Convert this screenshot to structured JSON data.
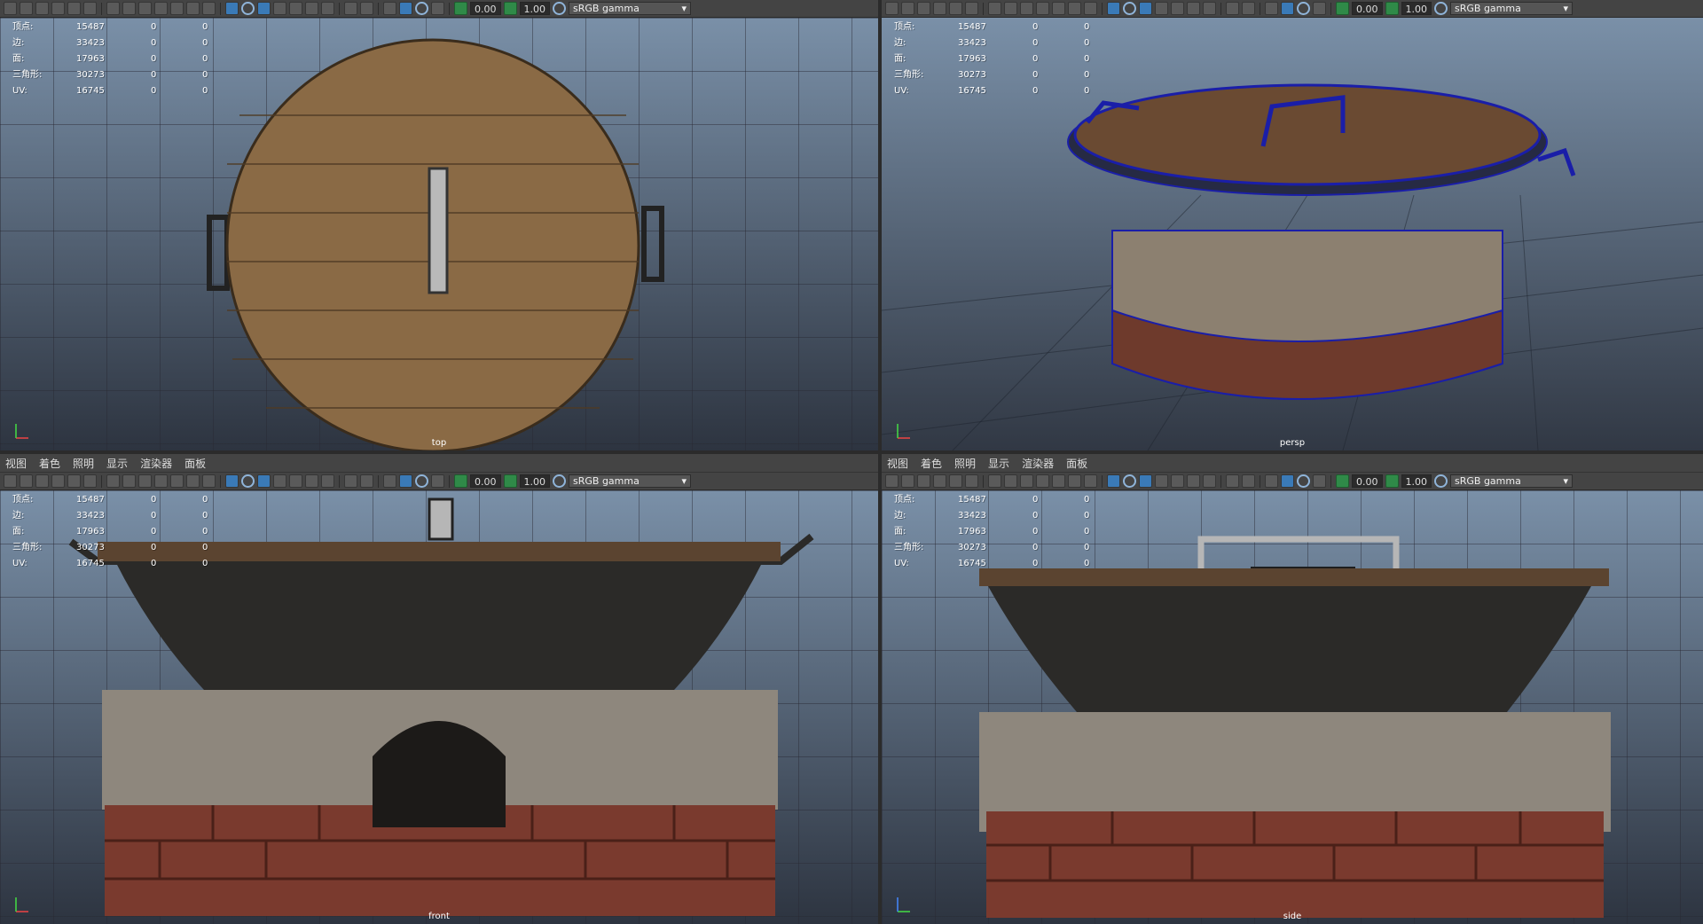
{
  "menu": [
    "视图",
    "着色",
    "照明",
    "显示",
    "渲染器",
    "面板"
  ],
  "toolbar": {
    "exposure": "0.00",
    "gamma": "1.00",
    "color_space": "sRGB gamma"
  },
  "hud": [
    {
      "label": "顶点:",
      "v1": "15487",
      "v2": "0",
      "v3": "0"
    },
    {
      "label": "边:",
      "v1": "33423",
      "v2": "0",
      "v3": "0"
    },
    {
      "label": "面:",
      "v1": "17963",
      "v2": "0",
      "v3": "0"
    },
    {
      "label": "三角形:",
      "v1": "30273",
      "v2": "0",
      "v3": "0"
    },
    {
      "label": "UV:",
      "v1": "16745",
      "v2": "0",
      "v3": "0"
    }
  ],
  "viewports": {
    "top": "top",
    "persp": "persp",
    "front": "front",
    "side": "side"
  },
  "colors": {
    "panel": "#444444",
    "viewport_top": "#7a90a8",
    "viewport_bottom": "#2d3440",
    "wood": "#8a6a45",
    "brick": "#7a3a2e",
    "wok": "#2b2a28"
  }
}
